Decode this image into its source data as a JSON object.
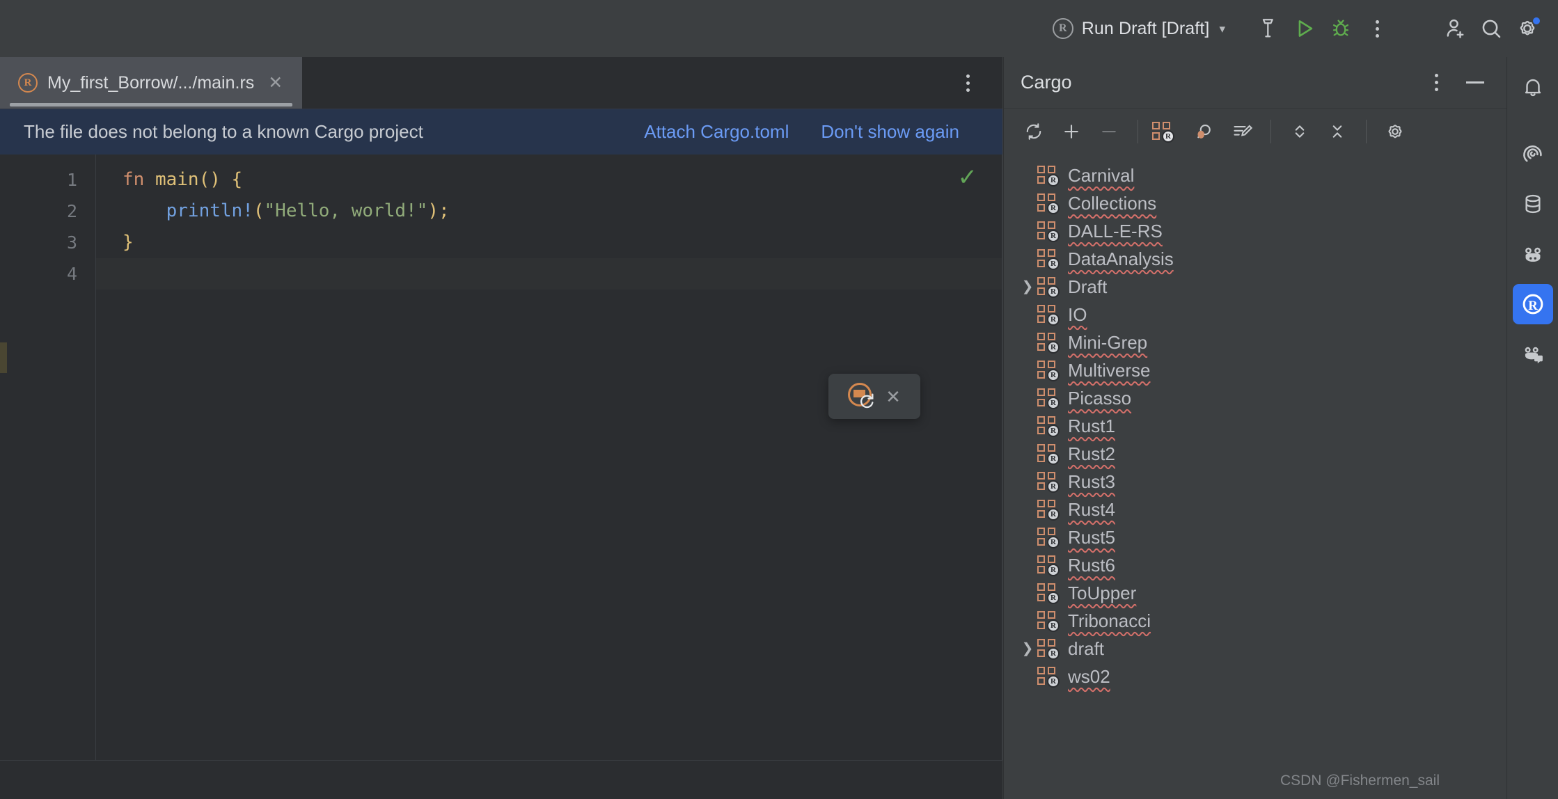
{
  "toolbar": {
    "run_config_label": "Run Draft [Draft]",
    "run_config_icon": "rust-circle-icon",
    "build_icon": "hammer-icon",
    "run_icon": "play-icon",
    "debug_icon": "bug-icon",
    "more_icon": "kebab-menu-icon",
    "add_user_icon": "add-user-icon",
    "search_icon": "search-icon",
    "settings_icon": "gear-icon",
    "settings_badge": true
  },
  "editor": {
    "tab": {
      "title": "My_first_Borrow/.../main.rs",
      "icon": "rust-file-icon",
      "close_icon": "close-icon"
    },
    "tab_actions_icon": "kebab-menu-icon",
    "banner": {
      "message": "The file does not belong to a known Cargo project",
      "links": [
        "Attach Cargo.toml",
        "Don't show again"
      ]
    },
    "line_numbers": [
      "1",
      "2",
      "3",
      "4"
    ],
    "code": [
      [
        {
          "t": "fn ",
          "c": "kw"
        },
        {
          "t": "main",
          "c": "fn"
        },
        {
          "t": "() {",
          "c": "punc"
        }
      ],
      [
        {
          "t": "    ",
          "c": "plain"
        },
        {
          "t": "println!",
          "c": "macro"
        },
        {
          "t": "(",
          "c": "punc"
        },
        {
          "t": "\"Hello, world!\"",
          "c": "str"
        },
        {
          "t": ");",
          "c": "punc"
        }
      ],
      [
        {
          "t": "}",
          "c": "punc"
        }
      ],
      [
        {
          "t": "",
          "c": "plain"
        }
      ]
    ],
    "inspection_icon": "green-checkmark-icon",
    "popup": {
      "refresh_icon": "rust-refresh-icon",
      "close_icon": "close-icon"
    }
  },
  "cargo": {
    "title": "Cargo",
    "head_more_icon": "kebab-menu-icon",
    "head_minimize_icon": "minimize-icon",
    "toolbar_icons": [
      "refresh-icon",
      "add-icon",
      "remove-icon",
      "separator",
      "cargo-project-icon",
      "debug-search-icon",
      "edit-run-args-icon",
      "separator",
      "expand-collapse-icon",
      "collapse-all-icon",
      "separator",
      "settings-gear-icon"
    ],
    "crates": [
      {
        "name": "Carnival",
        "expandable": false,
        "spell_error": true
      },
      {
        "name": "Collections",
        "expandable": false,
        "spell_error": true
      },
      {
        "name": "DALL-E-RS",
        "expandable": false,
        "spell_error": true
      },
      {
        "name": "DataAnalysis",
        "expandable": false,
        "spell_error": true
      },
      {
        "name": "Draft",
        "expandable": true,
        "spell_error": false
      },
      {
        "name": "IO",
        "expandable": false,
        "spell_error": true
      },
      {
        "name": "Mini-Grep",
        "expandable": false,
        "spell_error": true
      },
      {
        "name": "Multiverse",
        "expandable": false,
        "spell_error": true
      },
      {
        "name": "Picasso",
        "expandable": false,
        "spell_error": true
      },
      {
        "name": "Rust1",
        "expandable": false,
        "spell_error": true
      },
      {
        "name": "Rust2",
        "expandable": false,
        "spell_error": true
      },
      {
        "name": "Rust3",
        "expandable": false,
        "spell_error": true
      },
      {
        "name": "Rust4",
        "expandable": false,
        "spell_error": true
      },
      {
        "name": "Rust5",
        "expandable": false,
        "spell_error": true
      },
      {
        "name": "Rust6",
        "expandable": false,
        "spell_error": true
      },
      {
        "name": "ToUpper",
        "expandable": false,
        "spell_error": true
      },
      {
        "name": "Tribonacci",
        "expandable": false,
        "spell_error": true
      },
      {
        "name": "draft",
        "expandable": true,
        "spell_error": false
      },
      {
        "name": "ws02",
        "expandable": false,
        "spell_error": true
      }
    ]
  },
  "rail": {
    "items": [
      {
        "icon": "notifications-bell-icon",
        "active": false
      },
      {
        "icon": "ai-assistant-spiral-icon",
        "active": false
      },
      {
        "icon": "database-icon",
        "active": false
      },
      {
        "icon": "ai-monkey-icon",
        "active": false
      },
      {
        "icon": "rust-tool-icon",
        "active": true
      },
      {
        "icon": "ai-chat-icon",
        "active": false
      }
    ]
  },
  "watermark": "CSDN @Fishermen_sail",
  "colors": {
    "accent_blue": "#3574f0",
    "rust_orange": "#cf8e6d",
    "banner_bg": "#27344c",
    "link_blue": "#6b9bf5",
    "editor_bg": "#2b2d30",
    "panel_bg": "#3c3f41",
    "ok_green": "#62a557"
  }
}
